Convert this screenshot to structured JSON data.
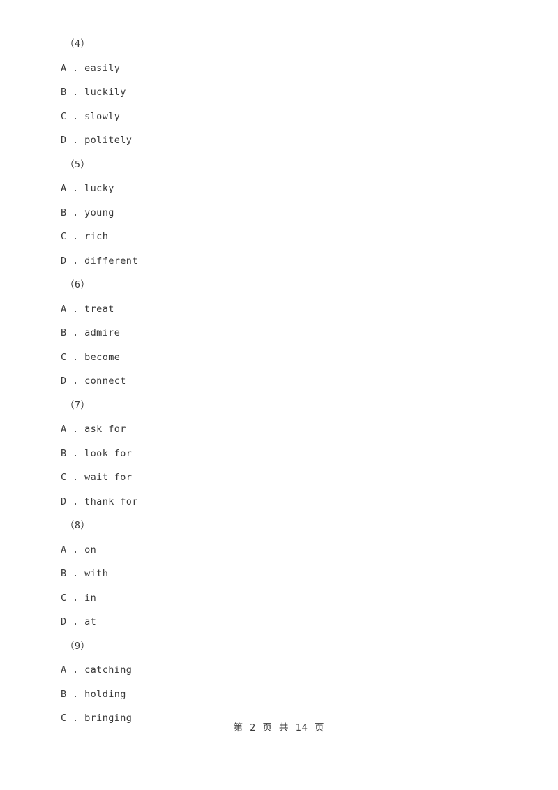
{
  "document": {
    "page_background": "#ffffff",
    "text_color": "#3a3a3a"
  },
  "questions": [
    {
      "number": "（4）",
      "options": [
        "A . easily",
        "B . luckily",
        "C . slowly",
        "D . politely"
      ]
    },
    {
      "number": "（5）",
      "options": [
        "A . lucky",
        "B . young",
        "C . rich",
        "D . different"
      ]
    },
    {
      "number": "（6）",
      "options": [
        "A . treat",
        "B . admire",
        "C . become",
        "D . connect"
      ]
    },
    {
      "number": "（7）",
      "options": [
        "A . ask for",
        "B . look for",
        "C . wait for",
        "D . thank for"
      ]
    },
    {
      "number": "（8）",
      "options": [
        "A . on",
        "B . with",
        "C . in",
        "D . at"
      ]
    },
    {
      "number": "（9）",
      "options": [
        "A . catching",
        "B . holding",
        "C . bringing"
      ]
    }
  ],
  "footer": {
    "page_label": "第 2 页 共 14 页",
    "current_page": "2",
    "total_pages": "14"
  }
}
